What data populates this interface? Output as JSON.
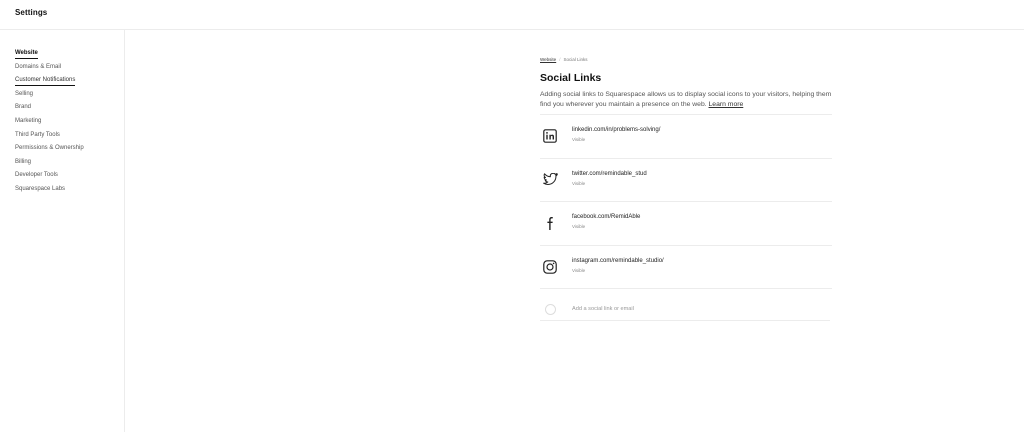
{
  "header": {
    "title": "Settings"
  },
  "sidebar": {
    "items": [
      {
        "label": "Website"
      },
      {
        "label": "Domains & Email"
      },
      {
        "label": "Customer Notifications"
      },
      {
        "label": "Selling"
      },
      {
        "label": "Brand"
      },
      {
        "label": "Marketing"
      },
      {
        "label": "Third Party Tools"
      },
      {
        "label": "Permissions & Ownership"
      },
      {
        "label": "Billing"
      },
      {
        "label": "Developer Tools"
      },
      {
        "label": "Squarespace Labs"
      }
    ]
  },
  "breadcrumb": {
    "parent": "Website",
    "current": "Social Links"
  },
  "main": {
    "title": "Social Links",
    "description": "Adding social links to Squarespace allows us to display social icons to your visitors, helping them find you wherever you maintain a presence on the web.",
    "learn_more": "Learn more"
  },
  "links": [
    {
      "icon": "linkedin-icon",
      "url": "linkedin.com/in/problems-solving/",
      "status": "Visible"
    },
    {
      "icon": "twitter-icon",
      "url": "twitter.com/remindable_stud",
      "status": "Visible"
    },
    {
      "icon": "facebook-icon",
      "url": "facebook.com/RemidAble",
      "status": "Visible"
    },
    {
      "icon": "instagram-icon",
      "url": "instagram.com/remindable_studio/",
      "status": "Visible"
    }
  ],
  "add_link": {
    "placeholder": "Add a social link or email"
  }
}
